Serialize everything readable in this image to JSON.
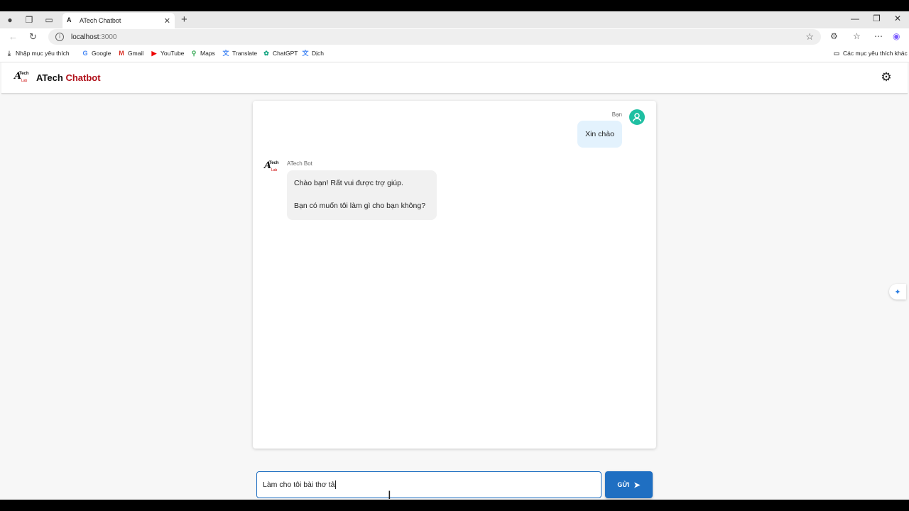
{
  "browser": {
    "tab_title": "ATech Chatbot",
    "tab_close": "✕",
    "new_tab": "+",
    "url_host": "localhost",
    "url_port": ":3000",
    "bookmarks": [
      {
        "label": "Nhập mục yêu thích",
        "icon": "folder-import-icon"
      },
      {
        "label": "Google",
        "icon": "google-icon"
      },
      {
        "label": "Gmail",
        "icon": "gmail-icon"
      },
      {
        "label": "YouTube",
        "icon": "youtube-icon"
      },
      {
        "label": "Maps",
        "icon": "maps-icon"
      },
      {
        "label": "Translate",
        "icon": "translate-icon"
      },
      {
        "label": "ChatGPT",
        "icon": "chatgpt-icon"
      },
      {
        "label": "Dịch",
        "icon": "translate-icon"
      }
    ],
    "other_favorites": "Các mục yêu thích khác"
  },
  "app": {
    "brand_prefix": "ATech",
    "brand_suffix": "Chatbot",
    "brand_color": "#b1101a",
    "logo_letter": "A",
    "logo_tech": "Tech",
    "logo_lab": "Lab"
  },
  "chat": {
    "messages": [
      {
        "sender": "Bạn",
        "text": "Xin chào"
      },
      {
        "sender": "ATech Bot",
        "lines": [
          "Chào bạn! Rất vui được trợ giúp.",
          "Bạn có muốn tôi làm gì cho bạn không?"
        ]
      }
    ]
  },
  "composer": {
    "value": "Làm cho tôi bài thơ tả",
    "send_label": "GỬI",
    "accent": "#1f6fc2"
  }
}
